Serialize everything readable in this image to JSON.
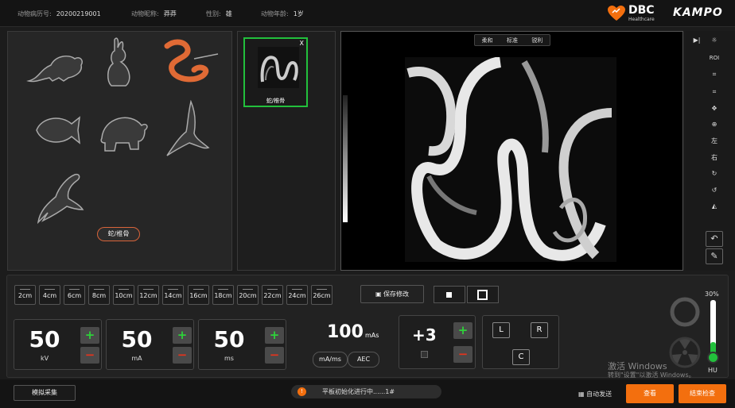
{
  "header": {
    "fields": [
      {
        "label": "动物病历号:",
        "value": "20200219001"
      },
      {
        "label": "动物昵称:",
        "value": "莽莽"
      },
      {
        "label": "性别:",
        "value": "雄"
      },
      {
        "label": "动物年龄:",
        "value": "1岁"
      }
    ],
    "logo_dbc": "DBC",
    "logo_dbc_sub": "Healthcare",
    "logo_kampo": "KAMPO"
  },
  "animals": {
    "items": [
      "rat",
      "rabbit",
      "snake",
      "fish",
      "turtle",
      "bird",
      "lizard"
    ],
    "selected": "snake",
    "selected_label": "蛇/椎骨"
  },
  "thumbnail": {
    "label": "蛇/椎骨",
    "close": "X"
  },
  "viewer": {
    "filters": [
      "柔和",
      "标准",
      "锐利"
    ]
  },
  "toolbar": {
    "roi_label": "ROI",
    "left_label": "左",
    "right_label": "右"
  },
  "thickness": {
    "items": [
      "2cm",
      "4cm",
      "6cm",
      "8cm",
      "10cm",
      "12cm",
      "14cm",
      "16cm",
      "18cm",
      "20cm",
      "22cm",
      "24cm",
      "26cm"
    ],
    "save_label": "保存修改"
  },
  "params": {
    "kv": {
      "value": "50",
      "unit": "kV"
    },
    "ma": {
      "value": "50",
      "unit": "mA"
    },
    "ms": {
      "value": "50",
      "unit": "ms"
    },
    "mas": {
      "value": "100",
      "unit": "mAs"
    },
    "mode_ma_ms": "mA/ms",
    "mode_aec": "AEC",
    "exposure": "+3",
    "positions": {
      "l": "L",
      "r": "R",
      "c": "C"
    }
  },
  "slider": {
    "percent_label": "30%",
    "unit": "HU",
    "value": 30
  },
  "statusbar": {
    "simulate": "模拟采集",
    "message": "平板初始化进行中......1#",
    "auto_send": "自动发送",
    "view_button": "查看",
    "end_button": "结束检查"
  },
  "watermark": {
    "line1": "激活 Windows",
    "line2": "转到\"设置\"以激活 Windows。"
  },
  "colors": {
    "accent": "#f36f0e",
    "select_green": "#22c03c",
    "plus": "#2ed23a",
    "minus": "#e2341d"
  }
}
